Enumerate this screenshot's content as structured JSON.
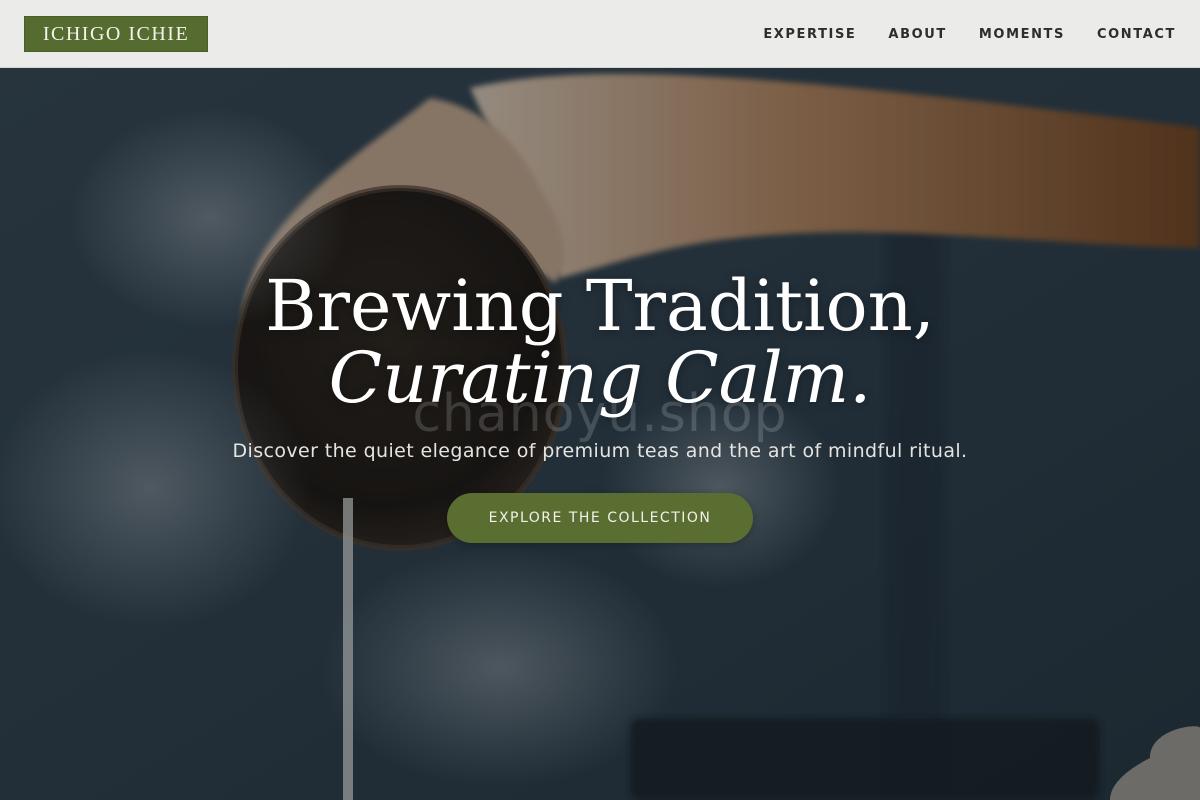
{
  "header": {
    "logo_text": "ICHIGO ICHIE",
    "nav": [
      {
        "label": "EXPERTISE"
      },
      {
        "label": "ABOUT"
      },
      {
        "label": "MOMENTS"
      },
      {
        "label": "CONTACT"
      }
    ]
  },
  "hero": {
    "headline_line1": "Brewing Tradition,",
    "headline_line2": "Curating Calm.",
    "watermark": "chanoyu.shop",
    "subtitle": "Discover the quiet elegance of premium teas and the art of mindful ritual.",
    "cta_label": "EXPLORE THE COLLECTION"
  },
  "colors": {
    "brand_green": "#556b2f",
    "cta_green": "#5a6e32",
    "header_bg": "#ebebea",
    "nav_text": "#2d2d2d"
  }
}
